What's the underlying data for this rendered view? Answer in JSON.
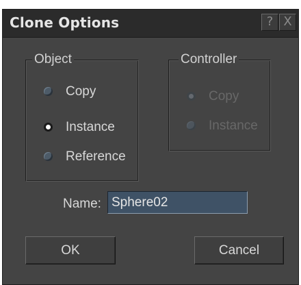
{
  "window": {
    "title": "Clone Options",
    "help_glyph": "?",
    "close_glyph": "X"
  },
  "object_group": {
    "legend": "Object",
    "options": [
      {
        "label": "Copy",
        "checked": false
      },
      {
        "label": "Instance",
        "checked": true
      },
      {
        "label": "Reference",
        "checked": false
      }
    ]
  },
  "controller_group": {
    "legend": "Controller",
    "enabled": false,
    "options": [
      {
        "label": "Copy",
        "checked": true
      },
      {
        "label": "Instance",
        "checked": false
      }
    ]
  },
  "name_field": {
    "label": "Name:",
    "value": "Sphere02"
  },
  "buttons": {
    "ok": "OK",
    "cancel": "Cancel"
  },
  "colors": {
    "dialog_bg": "#444444",
    "titlebar_bg": "#2b2b2b",
    "input_bg": "#3f5266",
    "text": "#d8d8d8",
    "disabled_text": "#686868"
  }
}
